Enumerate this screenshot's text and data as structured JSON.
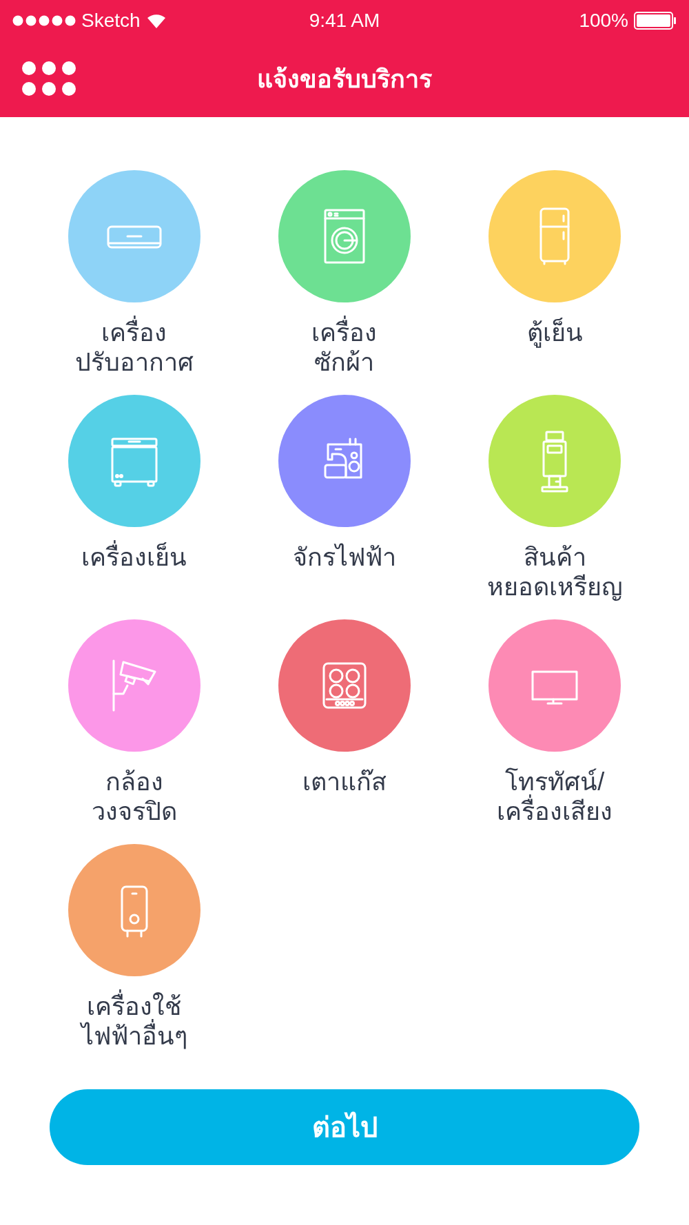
{
  "status_bar": {
    "carrier": "Sketch",
    "time": "9:41 AM",
    "battery": "100%"
  },
  "header": {
    "title": "แจ้งขอรับบริการ"
  },
  "services": [
    {
      "kind": "aircon",
      "color": "#8ed3f7",
      "label": "เครื่อง\nปรับอากาศ"
    },
    {
      "kind": "washer",
      "color": "#6de092",
      "label": "เครื่อง\nซักผ้า"
    },
    {
      "kind": "fridge",
      "color": "#fdd25e",
      "label": "ตู้เย็น"
    },
    {
      "kind": "freezer",
      "color": "#55d0e6",
      "label": "เครื่องเย็น"
    },
    {
      "kind": "sewing",
      "color": "#8a8cfd",
      "label": "จักรไฟฟ้า"
    },
    {
      "kind": "kiosk",
      "color": "#b9e753",
      "label": "สินค้า\nหยอดเหรียญ"
    },
    {
      "kind": "camera",
      "color": "#fc97e8",
      "label": "กล้อง\nวงจรปิด"
    },
    {
      "kind": "stove",
      "color": "#ee6c76",
      "label": "เตาแก๊ส"
    },
    {
      "kind": "tv",
      "color": "#fd8ab4",
      "label": "โทรทัศน์/\nเครื่องเสียง"
    },
    {
      "kind": "heater",
      "color": "#f5a26a",
      "label": "เครื่องใช้\nไฟฟ้าอื่นๆ"
    }
  ],
  "next_button": {
    "label": "ต่อไป"
  }
}
